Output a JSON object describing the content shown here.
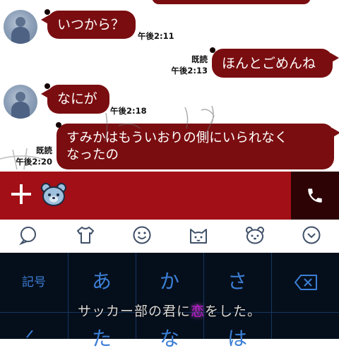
{
  "chat": {
    "messages": [
      {
        "side": "left",
        "text": "いつから？",
        "time": "午後2:11"
      },
      {
        "side": "right",
        "text": "ほんとごめんね",
        "read": "既読",
        "time": "午後2:13"
      },
      {
        "side": "left",
        "text": "なにが",
        "time": "午後2:18"
      },
      {
        "side": "right",
        "text_line1": "すみかはもういおりの側にいられなく",
        "text_line2": "なったの",
        "read": "既読",
        "time": "午後2:20"
      }
    ]
  },
  "input_bar": {
    "plus_icon": "plus-icon",
    "sticker_icon": "bear-face-icon",
    "call_icon": "phone-icon"
  },
  "toolbar": {
    "icons": [
      "search-icon",
      "tshirt-icon",
      "smiley-icon",
      "cat-face-icon",
      "bear-face-icon",
      "chevron-down-icon"
    ]
  },
  "keyboard": {
    "symbols_key": "記号",
    "row1": [
      "あ",
      "か",
      "さ"
    ],
    "row2": [
      "た",
      "な",
      "は"
    ],
    "backspace_icon": "backspace-icon",
    "left_arrow_icon": "arrow-left-icon"
  },
  "caption": {
    "before": "サッカー部の君に",
    "heart": "恋",
    "after": "をした。"
  },
  "colors": {
    "bubble": "#7a0d10",
    "input_bar": "#a20f16",
    "call_button": "#2d0305",
    "keyboard_bg": "#050f1c",
    "key_text": "#3c7fd6"
  }
}
